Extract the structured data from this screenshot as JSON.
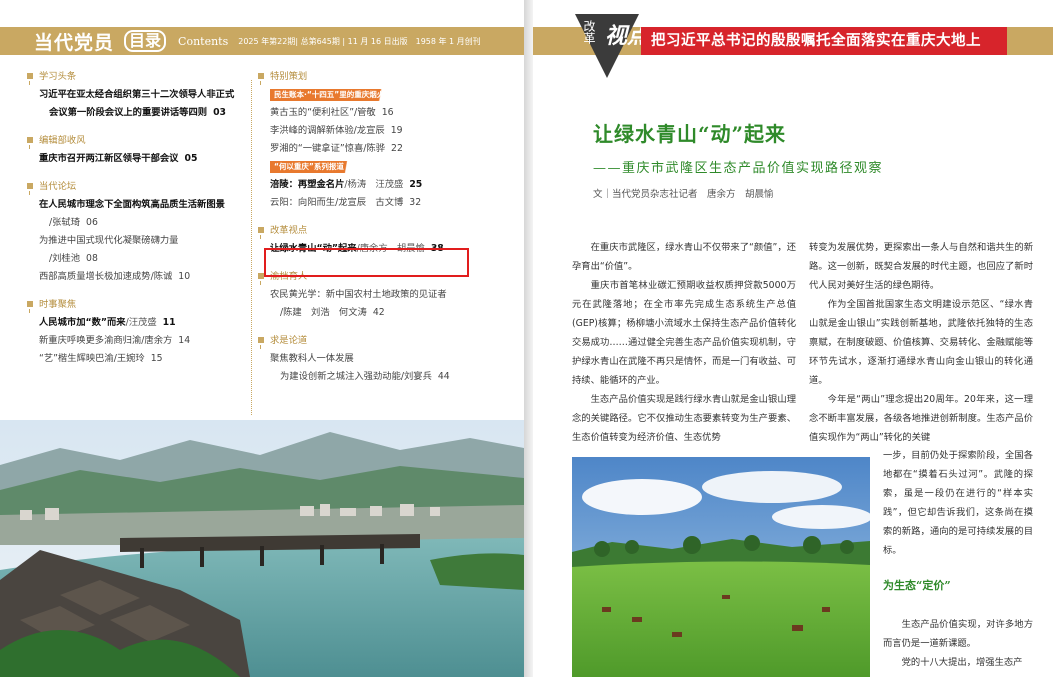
{
  "left": {
    "masthead": "当代党员",
    "mulu": "目录",
    "contents": "Contents",
    "issue": "2025 年第22期| 总第645期 | 11 月 16 日出版　1958 年 1 月创刊",
    "col1": [
      {
        "head": "学习头条",
        "entries": [
          {
            "t": "习近平在亚太经合组织第三十二次领导人非正式",
            "bold": true
          },
          {
            "t": "会议第一阶段会议上的重要讲话等四则",
            "pg": "03",
            "bold": true,
            "indent": true
          }
        ]
      },
      {
        "head": "编辑部收风",
        "entries": [
          {
            "t": "重庆市召开两江新区领导干部会议",
            "pg": "05",
            "bold": true
          }
        ]
      },
      {
        "head": "当代论坛",
        "entries": [
          {
            "t": "在人民城市理念下全面构筑高品质生活新图景",
            "bold": true
          },
          {
            "t": "/张轼琦",
            "pg": "06",
            "indent": true
          },
          {
            "t": "为推进中国式现代化凝聚磅礴力量"
          },
          {
            "t": "/刘桂池",
            "pg": "08",
            "indent": true
          },
          {
            "t": "西部高质量增长极加速成势/陈诚",
            "pg": "10"
          }
        ]
      },
      {
        "head": "时事聚焦",
        "entries": [
          {
            "t": "人民城市加“数”而来",
            "au": "/汪茂盛",
            "pg": "11",
            "bold": true
          },
          {
            "t": "新重庆呼唤更多渝商归渝/唐余方",
            "pg": "14"
          },
          {
            "t": "“艺”楷生辉映巴渝/王婉玲",
            "pg": "15"
          }
        ]
      }
    ],
    "col2": [
      {
        "head": "特别策划",
        "tag": "民生账本·“十四五”里的重庆烟火",
        "entries": [
          {
            "t": "黄古玉的“便利社区”/管敬",
            "pg": "16"
          },
          {
            "t": "李洪峰的调解新体验/龙宣辰",
            "pg": "19"
          },
          {
            "t": "罗湘的“一键拿证”惊喜/陈骅",
            "pg": "22"
          }
        ],
        "tag2": "“何以重庆”系列报道",
        "entries2": [
          {
            "t": "涪陵：再塑金名片",
            "au": "/杨涛　汪茂盛",
            "pg": "25",
            "bold": true
          },
          {
            "t": "云阳：向阳而生/龙宣辰　古文博",
            "pg": "32"
          }
        ]
      },
      {
        "head": "改革视点",
        "entries": [
          {
            "t": "让绿水青山“动”起来",
            "au": "/唐余方　胡晨愉",
            "pg": "38",
            "bold": true
          }
        ]
      },
      {
        "head": "渝档育人",
        "entries": [
          {
            "t": "农民黄光学：新中国农村土地政策的见证者"
          },
          {
            "t": "/陈建　刘浩　何文涛",
            "pg": "42",
            "indent": true
          }
        ]
      },
      {
        "head": "求是论道",
        "entries": [
          {
            "t": "聚焦教科人一体发展"
          },
          {
            "t": "为建设创新之城注入强劲动能/刘宴兵",
            "pg": "44",
            "indent": true
          }
        ]
      }
    ]
  },
  "right": {
    "column_name_small": "改革",
    "column_name_big": "视点",
    "banner": "把习近平总书记的殷殷嘱托全面落实在重庆大地上",
    "title": "让绿水青山“动”起来",
    "subtitle": "——重庆市武隆区生态产品价值实现路径观察",
    "byline": "文｜当代党员杂志社记者　唐余方　胡晨愉",
    "col1": [
      "在重庆市武隆区，绿水青山不仅带来了“颜值”，还孕育出“价值”。",
      "重庆市首笔林业碳汇预期收益权质押贷款5000万元在武隆落地；在全市率先完成生态系统生产总值(GEP)核算；杨柳塘小流域水土保持生态产品价值转化交易成功……通过健全完善生态产品价值实现机制，守护绿水青山在武隆不再只是情怀，而是一门有收益、可持续、能循环的产业。",
      "生态产品价值实现是践行绿水青山就是金山银山理念的关键路径。它不仅推动生态要素转变为生产要素、生态价值转变为经济价值、生态优势"
    ],
    "col2": [
      "转变为发展优势，更探索出一条人与自然和谐共生的新路。这一创新，既契合发展的时代主题，也回应了新时代人民对美好生活的绿色期待。",
      "作为全国首批国家生态文明建设示范区、“绿水青山就是金山银山”实践创新基地，武隆依托独特的生态禀赋，在制度破题、价值核算、交易转化、金融赋能等环节先试水，逐渐打通绿水青山向金山银山的转化通道。",
      "今年是“两山”理念提出20周年。20年来，这一理念不断丰富发展，各级各地推进创新制度。生态产品价值实现作为“两山”转化的关键"
    ],
    "col3": "一步，目前仍处于探索阶段，全国各地都在“摸着石头过河”。武隆的探索，虽是一段仍在进行的“样本实践”，但它却告诉我们，这条尚在摸索的新路，通向的是可持续发展的目标。",
    "subhead": "为生态“定价”",
    "col4": [
      "生态产品价值实现，对许多地方而言仍是一道新课题。",
      "党的十八大提出，增强生态产"
    ]
  }
}
